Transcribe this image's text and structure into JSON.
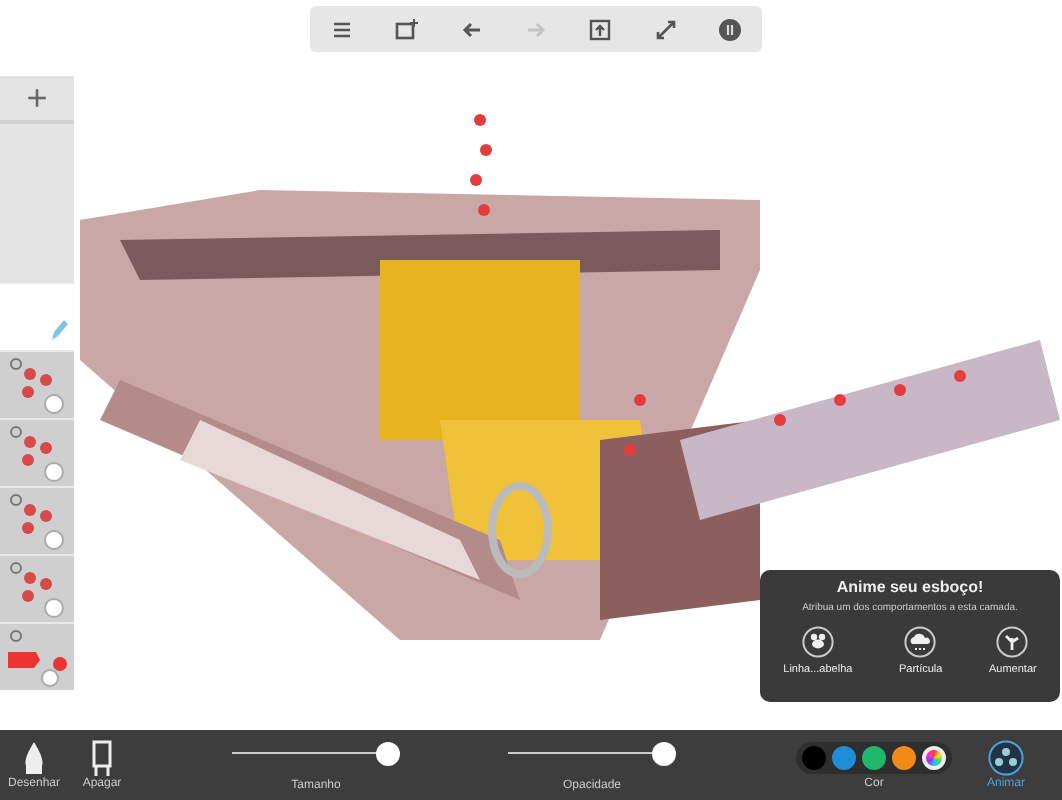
{
  "toolbar": [
    {
      "kind": "menu",
      "disabled": false
    },
    {
      "kind": "frame",
      "disabled": false
    },
    {
      "kind": "undo",
      "disabled": false
    },
    {
      "kind": "redo",
      "disabled": true
    },
    {
      "kind": "import",
      "disabled": false
    },
    {
      "kind": "expand",
      "disabled": false
    },
    {
      "kind": "pause",
      "disabled": false
    }
  ],
  "layers": {
    "add_label": "+",
    "items": [
      {
        "kind": "blank",
        "selected": true
      },
      {
        "kind": "particles",
        "selected": false
      },
      {
        "kind": "particles",
        "selected": false
      },
      {
        "kind": "particles",
        "selected": false
      },
      {
        "kind": "particles",
        "selected": false
      },
      {
        "kind": "shape",
        "selected": false
      }
    ]
  },
  "popover": {
    "title": "Anime seu esboço!",
    "subtitle": "Atribua um dos comportamentos a esta camada.",
    "options": [
      {
        "kind": "bee",
        "label": "Linha...abelha"
      },
      {
        "kind": "cloud",
        "label": "Partícula"
      },
      {
        "kind": "grow",
        "label": "Aumentar"
      }
    ]
  },
  "bottom_bar": {
    "tools": [
      {
        "kind": "pen",
        "label": "Desenhar",
        "selected": false
      },
      {
        "kind": "eraser",
        "label": "Apagar",
        "selected": false
      }
    ],
    "sliders": [
      {
        "label": "Tamanho",
        "level": 1
      },
      {
        "label": "Opacidade",
        "level": 1
      }
    ],
    "colors": [
      {
        "kind": "swatch",
        "color": "#000000"
      },
      {
        "kind": "swatch",
        "color": "#1e8fd6"
      },
      {
        "kind": "swatch",
        "color": "#1fb86a"
      },
      {
        "kind": "swatch",
        "color": "#f28a1a"
      },
      {
        "kind": "wheel"
      }
    ],
    "colors_label": "Cor",
    "animate": {
      "label": "Animar",
      "selected": true
    }
  }
}
